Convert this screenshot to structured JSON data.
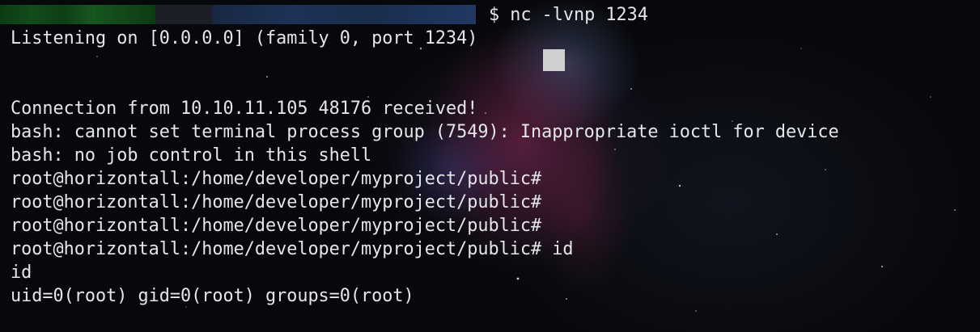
{
  "terminal": {
    "prompt_command": "$ nc -lvnp 1234",
    "lines": [
      "Listening on [0.0.0.0] (family 0, port 1234)",
      "",
      "",
      "Connection from 10.10.11.105 48176 received!",
      "bash: cannot set terminal process group (7549): Inappropriate ioctl for device",
      "bash: no job control in this shell",
      "root@horizontall:/home/developer/myproject/public#",
      "root@horizontall:/home/developer/myproject/public#",
      "root@horizontall:/home/developer/myproject/public#",
      "root@horizontall:/home/developer/myproject/public# id",
      "id",
      "uid=0(root) gid=0(root) groups=0(root)"
    ]
  },
  "colors": {
    "text": "#e4e6ea",
    "background": "#07080b",
    "cursor": "#cfcfd2"
  }
}
